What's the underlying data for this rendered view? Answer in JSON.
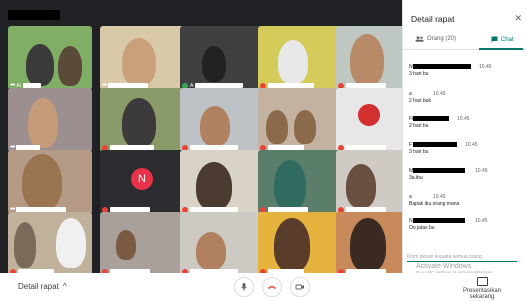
{
  "panel": {
    "title": "Detail rapat",
    "close_glyph": "✕",
    "tabs": [
      {
        "label": "Orang (20)",
        "icon": "people-icon",
        "active": false
      },
      {
        "label": "Chat",
        "icon": "chat-icon",
        "active": true
      }
    ]
  },
  "chat": {
    "messages": [
      {
        "sender": "N",
        "time": "10.45",
        "text": "3 hari bu"
      },
      {
        "sender": "a",
        "time": "10.45",
        "text": "2 hari buk"
      },
      {
        "sender": "Fi",
        "time": "10.45",
        "text": "2 hari bu"
      },
      {
        "sender": "F",
        "time": "10.45",
        "text": "3 hari bu"
      },
      {
        "sender": "M",
        "time": "10.45",
        "text": "3a.ibu"
      },
      {
        "sender": "a",
        "time": "10.45",
        "text": "Bapak ibu orang mana"
      },
      {
        "sender": "N",
        "time": "10.45",
        "text": "Oo jatas bu"
      }
    ],
    "input_placeholder": "Kirim pesan kepada semua orang"
  },
  "grid": {
    "tile_labels": [
      "Ai",
      "Nat",
      "A",
      "",
      "",
      "",
      "",
      "",
      "",
      "",
      "",
      "",
      "",
      "",
      "",
      "",
      "",
      "",
      "",
      ""
    ],
    "avatar_letter": "N"
  },
  "bottombar": {
    "meeting_details": "Detail rapat",
    "chevron": "^",
    "present_label": "Presentasikan sekarang"
  },
  "watermark": {
    "title": "Activate Windows",
    "subtitle": "Go to PC settings to activate Windows."
  },
  "colors": {
    "accent": "#00796b",
    "grid_bg": "#202124",
    "mic_off": "#ea4335",
    "end_call": "#ea4335"
  }
}
